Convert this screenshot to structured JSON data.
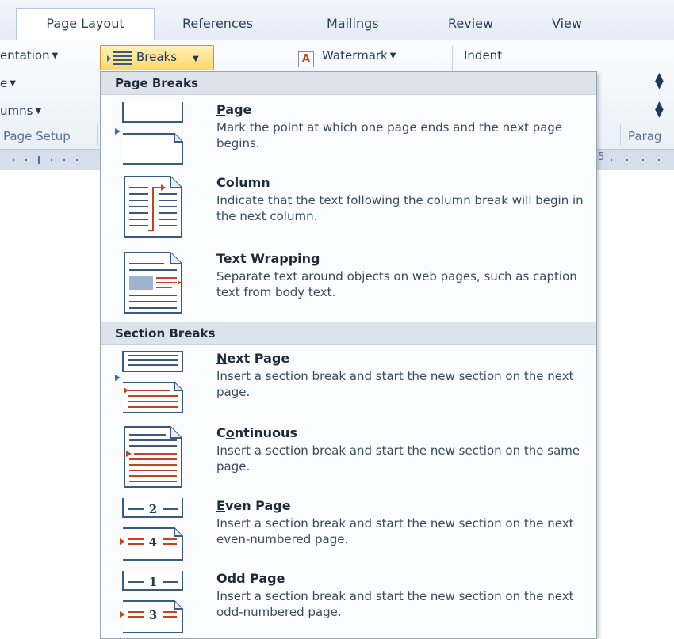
{
  "ribbon_tabs": [
    {
      "label": "Page Layout",
      "active": true
    },
    {
      "label": "References"
    },
    {
      "label": "Mailings"
    },
    {
      "label": "Review"
    },
    {
      "label": "View"
    }
  ],
  "ribbon": {
    "orientation_label": "entation",
    "size_label": "e",
    "columns_label": "umns",
    "page_setup_label": "Page Setup",
    "breaks_label": "Breaks",
    "watermark_label": "Watermark",
    "indent_label": "Indent",
    "paragraph_label": "Parag",
    "ruler_mark": "5"
  },
  "menu": {
    "page_breaks_header": "Page Breaks",
    "section_breaks_header": "Section Breaks",
    "items": [
      {
        "title_u": "P",
        "title_rest": "age",
        "desc": "Mark the point at which one page ends and the next page begins.",
        "icon": "page-break-icon"
      },
      {
        "title_u": "C",
        "title_rest": "olumn",
        "desc": "Indicate that the text following the column break will begin in the next column.",
        "icon": "column-break-icon"
      },
      {
        "title_u": "T",
        "title_rest": "ext Wrapping",
        "desc": "Separate text around objects on web pages, such as caption text from body text.",
        "icon": "text-wrapping-icon"
      },
      {
        "title_u": "N",
        "title_rest": "ext Page",
        "desc": "Insert a section break and start the new section on the next page.",
        "icon": "next-page-icon"
      },
      {
        "title_pre": "C",
        "title_u": "o",
        "title_rest": "ntinuous",
        "desc": "Insert a section break and start the new section on the same page.",
        "icon": "continuous-icon"
      },
      {
        "title_u": "E",
        "title_rest": "ven Page",
        "desc": "Insert a section break and start the new section on the next even-numbered page.",
        "icon": "even-page-icon",
        "numbers": [
          "2",
          "4"
        ]
      },
      {
        "title_pre": "O",
        "title_u": "d",
        "title_rest": "d Page",
        "desc": "Insert a section break and start the new section on the next odd-numbered page.",
        "icon": "odd-page-icon",
        "numbers": [
          "1",
          "3"
        ]
      }
    ]
  },
  "colors": {
    "accent_red": "#c8401e",
    "accent_blue": "#2f6fc0",
    "highlight": "#ffd768"
  }
}
